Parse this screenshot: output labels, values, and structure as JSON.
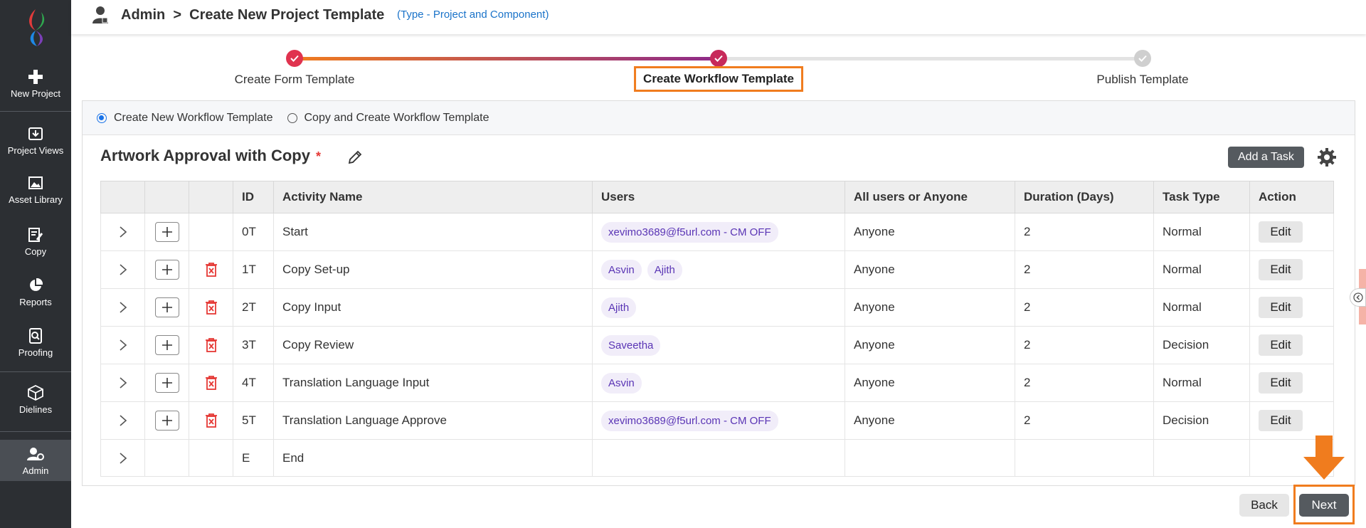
{
  "sidebar": {
    "items": [
      {
        "label": "New Project",
        "icon": "plus-icon"
      },
      {
        "label": "Project Views",
        "icon": "download-box-icon"
      },
      {
        "label": "Asset Library",
        "icon": "image-icon"
      },
      {
        "label": "Copy",
        "icon": "document-edit-icon"
      },
      {
        "label": "Reports",
        "icon": "pie-chart-icon"
      },
      {
        "label": "Proofing",
        "icon": "magnify-document-icon"
      },
      {
        "label": "Dielines",
        "icon": "box-icon"
      },
      {
        "label": "Admin",
        "icon": "admin-user-icon"
      }
    ]
  },
  "header": {
    "breadcrumb": "Admin  >  Create New Project Template",
    "subtitle": "(Type - Project and Component)"
  },
  "stepper": {
    "steps": [
      {
        "label": "Create Form Template",
        "state": "done"
      },
      {
        "label": "Create Workflow Template",
        "state": "current"
      },
      {
        "label": "Publish Template",
        "state": "pending"
      }
    ]
  },
  "options": {
    "create_new": "Create New Workflow Template",
    "copy_create": "Copy and Create Workflow Template",
    "selected": "create_new"
  },
  "template": {
    "title": "Artwork Approval with Copy",
    "required_mark": "*",
    "add_task_label": "Add a Task"
  },
  "table": {
    "headers": {
      "id": "ID",
      "activity": "Activity Name",
      "users": "Users",
      "all_or_any": "All users or Anyone",
      "duration": "Duration (Days)",
      "task_type": "Task Type",
      "action": "Action"
    },
    "rows": [
      {
        "id": "0T",
        "activity": "Start",
        "users": [
          "xevimo3689@f5url.com - CM OFF"
        ],
        "mode": "Anyone",
        "duration": "2",
        "type": "Normal",
        "action": "Edit"
      },
      {
        "id": "1T",
        "activity": "Copy Set-up",
        "users": [
          "Asvin",
          "Ajith"
        ],
        "mode": "Anyone",
        "duration": "2",
        "type": "Normal",
        "action": "Edit"
      },
      {
        "id": "2T",
        "activity": "Copy Input",
        "users": [
          "Ajith"
        ],
        "mode": "Anyone",
        "duration": "2",
        "type": "Normal",
        "action": "Edit"
      },
      {
        "id": "3T",
        "activity": "Copy Review",
        "users": [
          "Saveetha"
        ],
        "mode": "Anyone",
        "duration": "2",
        "type": "Decision",
        "action": "Edit"
      },
      {
        "id": "4T",
        "activity": "Translation Language Input",
        "users": [
          "Asvin"
        ],
        "mode": "Anyone",
        "duration": "2",
        "type": "Normal",
        "action": "Edit"
      },
      {
        "id": "5T",
        "activity": "Translation Language Approve",
        "users": [
          "xevimo3689@f5url.com - CM OFF"
        ],
        "mode": "Anyone",
        "duration": "2",
        "type": "Decision",
        "action": "Edit"
      },
      {
        "id": "E",
        "activity": "End",
        "users": [],
        "mode": "",
        "duration": "",
        "type": "",
        "action": ""
      }
    ]
  },
  "footer": {
    "back_label": "Back",
    "next_label": "Next"
  },
  "colors": {
    "sidebar_bg": "#2c2f33",
    "accent_orange": "#f07c1e",
    "link_blue": "#1a73c9",
    "chip_text": "#5a35b5",
    "delete_red": "#e53935"
  }
}
